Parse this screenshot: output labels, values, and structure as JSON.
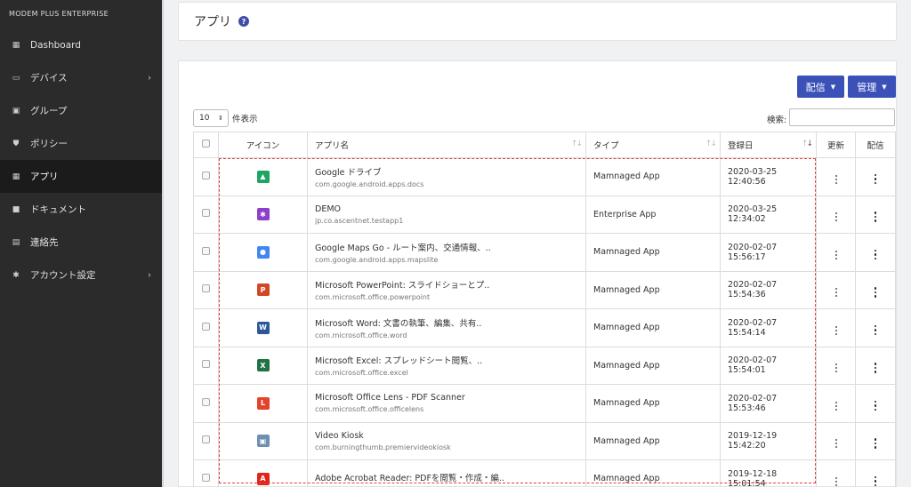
{
  "sidebar": {
    "brand": "MODEM PLUS ENTERPRISE",
    "items": [
      {
        "label": "Dashboard",
        "icon": "dashboard-icon",
        "glyph": "▦",
        "chevron": false,
        "active": false
      },
      {
        "label": "デバイス",
        "icon": "device-icon",
        "glyph": "▭",
        "chevron": true,
        "active": false
      },
      {
        "label": "グループ",
        "icon": "group-icon",
        "glyph": "▣",
        "chevron": false,
        "active": false
      },
      {
        "label": "ポリシー",
        "icon": "shield-icon",
        "glyph": "⛊",
        "chevron": false,
        "active": false
      },
      {
        "label": "アプリ",
        "icon": "apps-grid-icon",
        "glyph": "▦",
        "chevron": false,
        "active": true
      },
      {
        "label": "ドキュメント",
        "icon": "folder-icon",
        "glyph": "■",
        "chevron": false,
        "active": false
      },
      {
        "label": "連絡先",
        "icon": "contact-card-icon",
        "glyph": "▤",
        "chevron": false,
        "active": false
      },
      {
        "label": "アカウント設定",
        "icon": "gear-icon",
        "glyph": "✱",
        "chevron": true,
        "active": false
      }
    ]
  },
  "header": {
    "title": "アプリ",
    "help": "?"
  },
  "toolbar": {
    "deliver_label": "配信",
    "manage_label": "管理"
  },
  "table_controls": {
    "page_length": "10",
    "page_length_suffix": "件表示",
    "search_label": "検索:"
  },
  "table": {
    "headers": {
      "icon": "アイコン",
      "name": "アプリ名",
      "type": "タイプ",
      "date": "登録日",
      "update": "更新",
      "deliver": "配信"
    },
    "rows": [
      {
        "name": "Google ドライブ",
        "pkg": "com.google.android.apps.docs",
        "type": "Mamnaged App",
        "date": "2020-03-25 12:40:56",
        "icon": "google-drive-icon",
        "glyph": "▲",
        "color": "#1fa463"
      },
      {
        "name": "DEMO",
        "pkg": "jp.co.ascentnet.testapp1",
        "type": "Enterprise App",
        "date": "2020-03-25 12:34:02",
        "icon": "demo-app-gear-icon",
        "glyph": "✱",
        "color": "#8e3fc9"
      },
      {
        "name": "Google Maps Go - ルート案内、交通情報、..",
        "pkg": "com.google.android.apps.mapslite",
        "type": "Mamnaged App",
        "date": "2020-02-07 15:56:17",
        "icon": "maps-pin-icon",
        "glyph": "●",
        "color": "#4285f4"
      },
      {
        "name": "Microsoft PowerPoint: スライドショーとプ..",
        "pkg": "com.microsoft.office.powerpoint",
        "type": "Mamnaged App",
        "date": "2020-02-07 15:54:36",
        "icon": "powerpoint-icon",
        "glyph": "P",
        "color": "#d24726"
      },
      {
        "name": "Microsoft Word: 文書の執筆、編集、共有..",
        "pkg": "com.microsoft.office.word",
        "type": "Mamnaged App",
        "date": "2020-02-07 15:54:14",
        "icon": "word-icon",
        "glyph": "W",
        "color": "#2b579a"
      },
      {
        "name": "Microsoft Excel: スプレッドシート閲覧、..",
        "pkg": "com.microsoft.office.excel",
        "type": "Mamnaged App",
        "date": "2020-02-07 15:54:01",
        "icon": "excel-icon",
        "glyph": "X",
        "color": "#217346"
      },
      {
        "name": "Microsoft Office Lens - PDF Scanner",
        "pkg": "com.microsoft.office.officelens",
        "type": "Mamnaged App",
        "date": "2020-02-07 15:53:46",
        "icon": "office-lens-icon",
        "glyph": "L",
        "color": "#e3422b"
      },
      {
        "name": "Video Kiosk",
        "pkg": "com.burningthumb.premiervideokiosk",
        "type": "Mamnaged App",
        "date": "2019-12-19 15:42:20",
        "icon": "video-kiosk-icon",
        "glyph": "▣",
        "color": "#6d8fb3"
      },
      {
        "name": "Adobe Acrobat Reader: PDFを閲覧・作成・編..",
        "pkg": "",
        "type": "Mamnaged App",
        "date": "2019-12-18 15:01:54",
        "icon": "acrobat-icon",
        "glyph": "A",
        "color": "#e1251b"
      }
    ]
  }
}
